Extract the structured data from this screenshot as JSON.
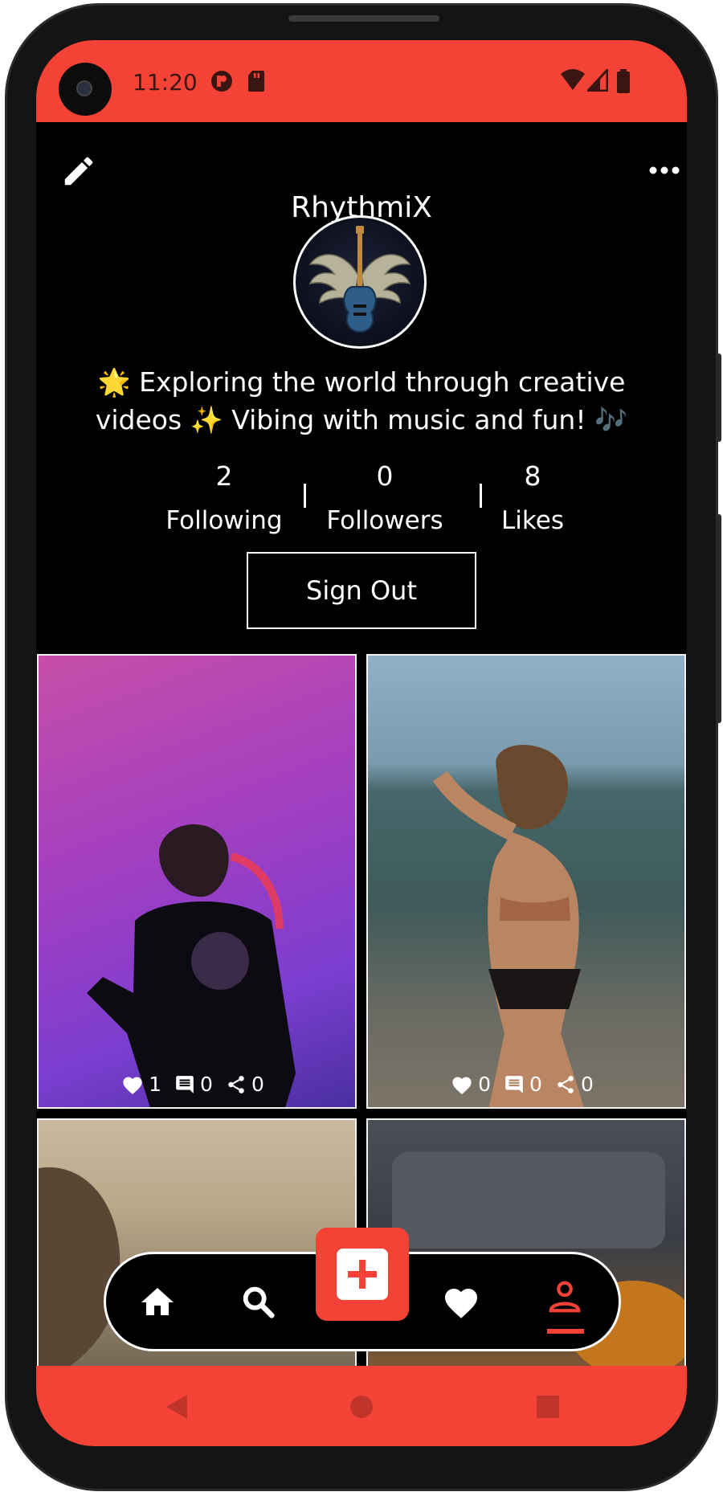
{
  "status_bar": {
    "time": "11:20"
  },
  "header": {
    "title": "RhythmiX"
  },
  "profile": {
    "bio": "🌟 Exploring the world through creative videos ✨ Vibing with music and fun! 🎶",
    "stats": [
      {
        "value": "2",
        "label": "Following"
      },
      {
        "value": "0",
        "label": "Followers"
      },
      {
        "value": "8",
        "label": "Likes"
      }
    ],
    "sign_out_label": "Sign Out"
  },
  "videos": [
    {
      "likes": "1",
      "comments": "0",
      "shares": "0"
    },
    {
      "likes": "0",
      "comments": "0",
      "shares": "0"
    },
    {
      "likes": "",
      "comments": "",
      "shares": ""
    },
    {
      "likes": "",
      "comments": "",
      "shares": ""
    }
  ],
  "bottom_nav": {
    "items": [
      {
        "icon": "home-icon"
      },
      {
        "icon": "search-icon"
      },
      {
        "icon": "add-icon"
      },
      {
        "icon": "heart-icon"
      },
      {
        "icon": "profile-icon",
        "active": true
      }
    ]
  },
  "colors": {
    "accent": "#f44336",
    "background": "#000000",
    "text": "#ffffff"
  }
}
